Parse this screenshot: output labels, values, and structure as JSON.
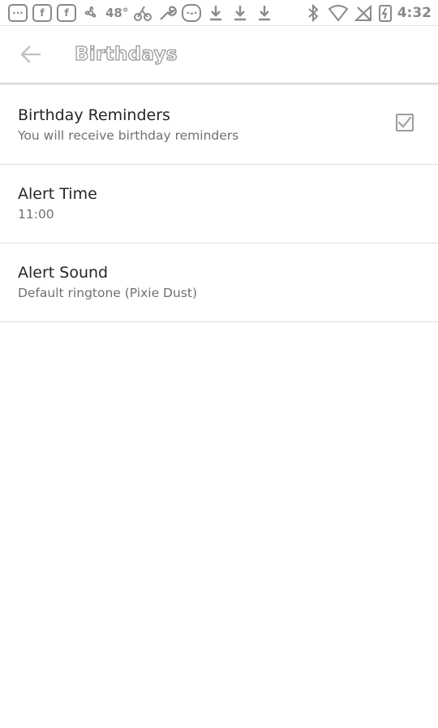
{
  "status_bar": {
    "left_icons": [
      "chat-icon",
      "facebook-icon",
      "facebook-icon",
      "fan-icon",
      "weather-icon",
      "bike-icon",
      "wrench-icon",
      "chat-bubble-icon",
      "download-icon",
      "download-icon",
      "download-icon"
    ],
    "temperature": "48°",
    "fb_letter": "f",
    "right_icons": [
      "bluetooth-icon",
      "wifi-icon",
      "no-signal-icon",
      "battery-icon"
    ],
    "time": "4:32"
  },
  "toolbar": {
    "back_icon": "arrow-left-icon",
    "title": "Birthdays"
  },
  "preferences": [
    {
      "title": "Birthday Reminders",
      "summary": "You will receive birthday reminders",
      "checked": true
    },
    {
      "title": "Alert Time",
      "summary": "11:00"
    },
    {
      "title": "Alert Sound",
      "summary": "Default ringtone (Pixie Dust)"
    }
  ],
  "colors": {
    "background": "#ffffff",
    "icon_gray": "#8a8a8a",
    "divider": "#dcdcdc",
    "title_text": "#262626",
    "summary_text": "#707070"
  }
}
